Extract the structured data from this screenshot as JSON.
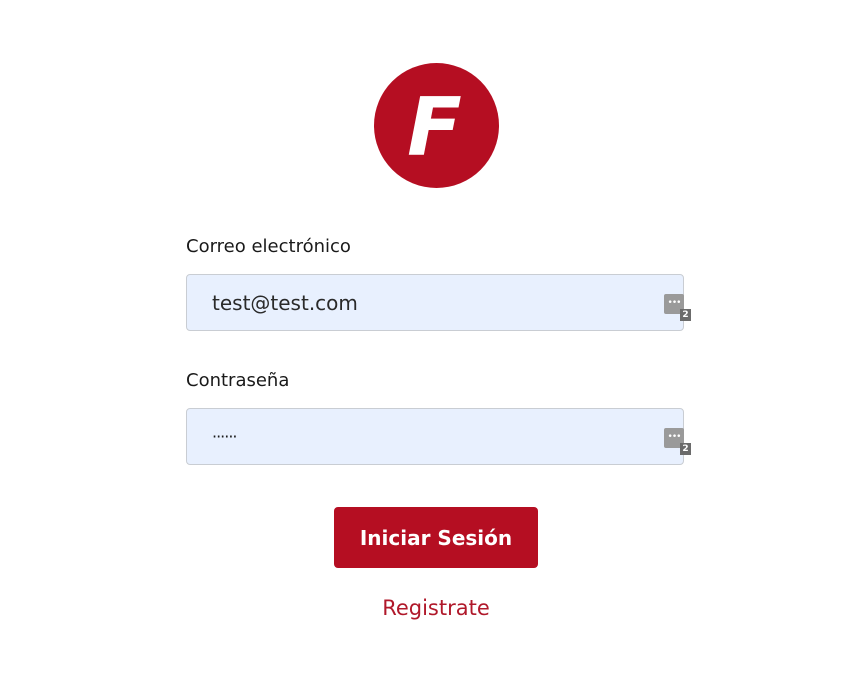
{
  "logo": {
    "letter": "F",
    "color": "#b50e22"
  },
  "form": {
    "email": {
      "label": "Correo electrónico",
      "value": "test@test.com"
    },
    "password": {
      "label": "Contraseña",
      "value": "······"
    },
    "password_manager": {
      "icon": "password-manager-icon",
      "glyph": "•••",
      "count": "2"
    },
    "submit_label": "Iniciar Sesión",
    "register_label": "Registrate"
  },
  "colors": {
    "accent": "#b50e22",
    "field_background": "#e8f0fe",
    "link": "#b0182a"
  }
}
